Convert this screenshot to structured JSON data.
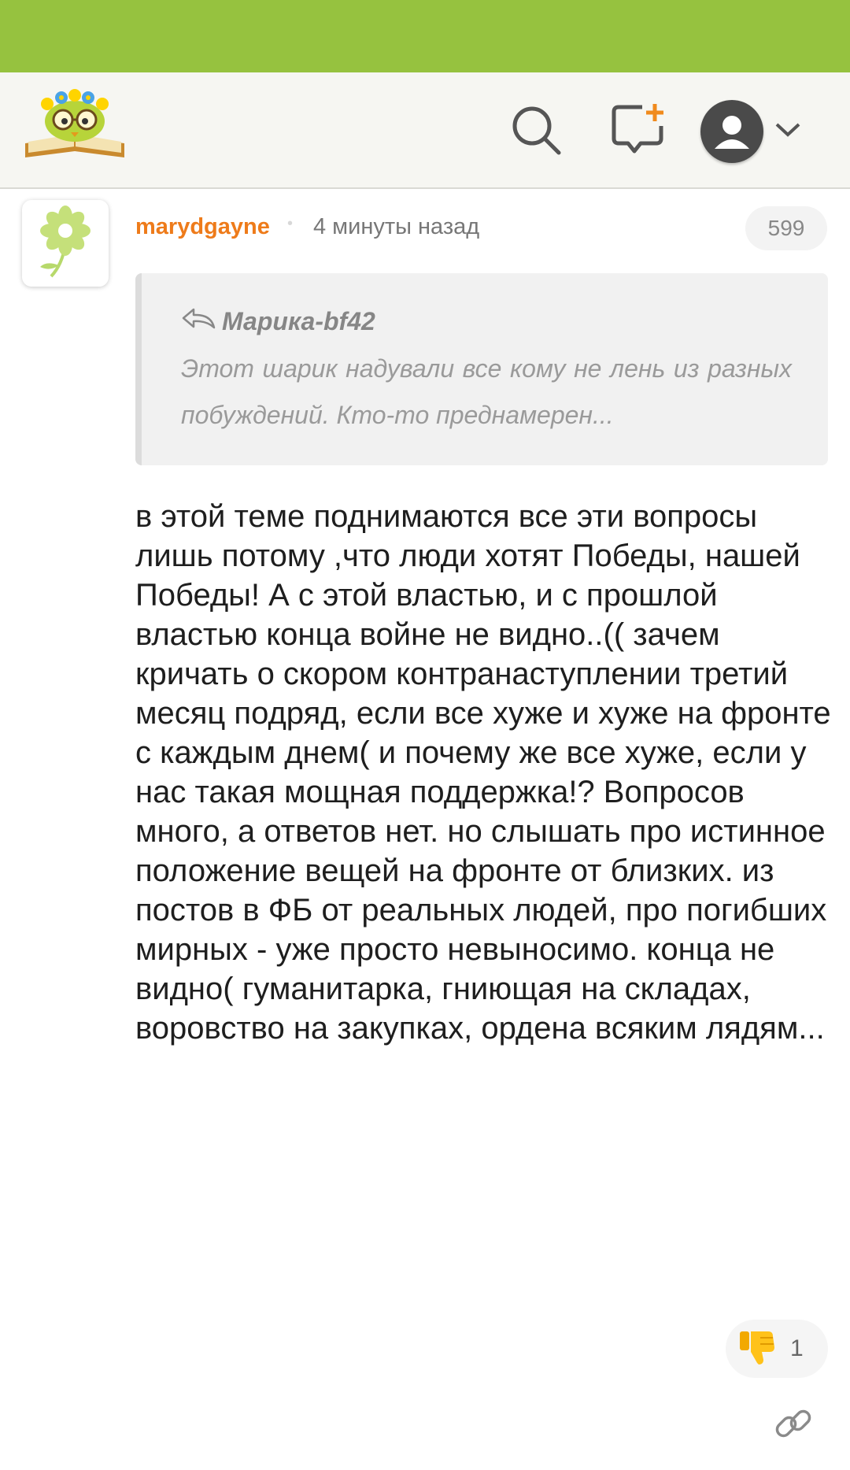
{
  "header": {
    "logo_icon": "reading-owl-logo-icon",
    "search_icon": "search-icon",
    "new_post_icon": "new-message-plus-icon",
    "profile_icon": "user-avatar-icon",
    "dropdown_icon": "chevron-down-icon"
  },
  "comment": {
    "username": "marydgayne",
    "separator": "•",
    "timestamp": "4 минуты назад",
    "rating": "599",
    "avatar_icon": "flower-avatar-icon",
    "quote": {
      "reply_icon": "reply-arrow-icon",
      "author": "Марика-bf42",
      "text": "Этот шарик надували все кому не лень из разных побуждений. Кто-то преднамерен..."
    },
    "body": "в этой теме поднимаются все эти вопросы лишь потому ,что люди хотят Победы, нашей Победы! А с этой властью, и с прошлой властью конца войне не видно..(( зачем кричать о скором контранаступлении третий месяц подряд, если все хуже и хуже на фронте с каждым днем( и почему же все хуже, если у нас такая мощная поддержка!? Вопросов много, а ответов нет. но слышать про истинное положение вещей на фронте от близких. из постов в ФБ от реальных людей, про погибших мирных - уже просто невыносимо. конца не видно( гуманитарка, гниющая на складах, воровство на закупках, ордена всяким лядям...",
    "dislike_icon": "thumbs-down-icon",
    "dislike_count": "1",
    "link_icon": "link-icon"
  },
  "colors": {
    "status_bar": "#96c23f",
    "header_bg": "#f6f6f2",
    "username": "#ee7b1a",
    "quote_bg": "#f1f1f1"
  }
}
